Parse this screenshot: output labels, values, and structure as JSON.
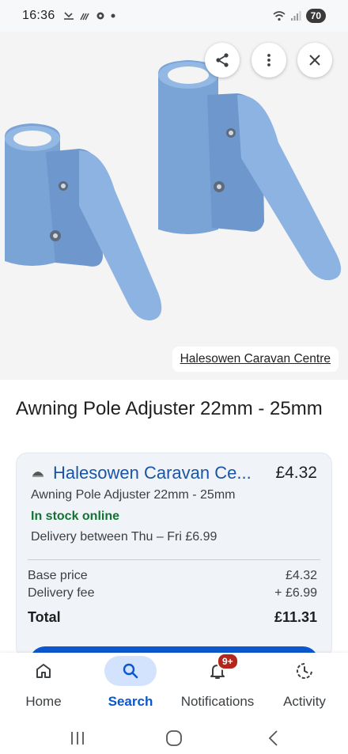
{
  "status_bar": {
    "time": "16:36",
    "battery": "70"
  },
  "hero": {
    "source_label": "Halesowen Caravan Centre",
    "share_icon": "share-icon",
    "more_icon": "more-vert-icon",
    "close_icon": "close-icon"
  },
  "product": {
    "title": "Awning Pole Adjuster 22mm - 25mm"
  },
  "offer": {
    "merchant_name": "Halesowen Caravan Ce...",
    "price": "£4.32",
    "item_name": "Awning Pole Adjuster 22mm - 25mm",
    "availability": "In stock online",
    "delivery": "Delivery between Thu – Fri £6.99",
    "base_price_label": "Base price",
    "base_price_value": "£4.32",
    "delivery_fee_label": "Delivery fee",
    "delivery_fee_value": "+ £6.99",
    "total_label": "Total",
    "total_value": "£11.31"
  },
  "bottom_nav": {
    "items": [
      {
        "label": "Home",
        "icon": "home-icon",
        "active": false
      },
      {
        "label": "Search",
        "icon": "search-icon",
        "active": true
      },
      {
        "label": "Notifications",
        "icon": "bell-icon",
        "active": false,
        "badge": "9+"
      },
      {
        "label": "Activity",
        "icon": "history-icon",
        "active": false
      }
    ]
  },
  "colors": {
    "accent": "#0b57d0",
    "in_stock": "#137333",
    "merchant_link": "#1a55a3",
    "badge": "#b3261e"
  }
}
